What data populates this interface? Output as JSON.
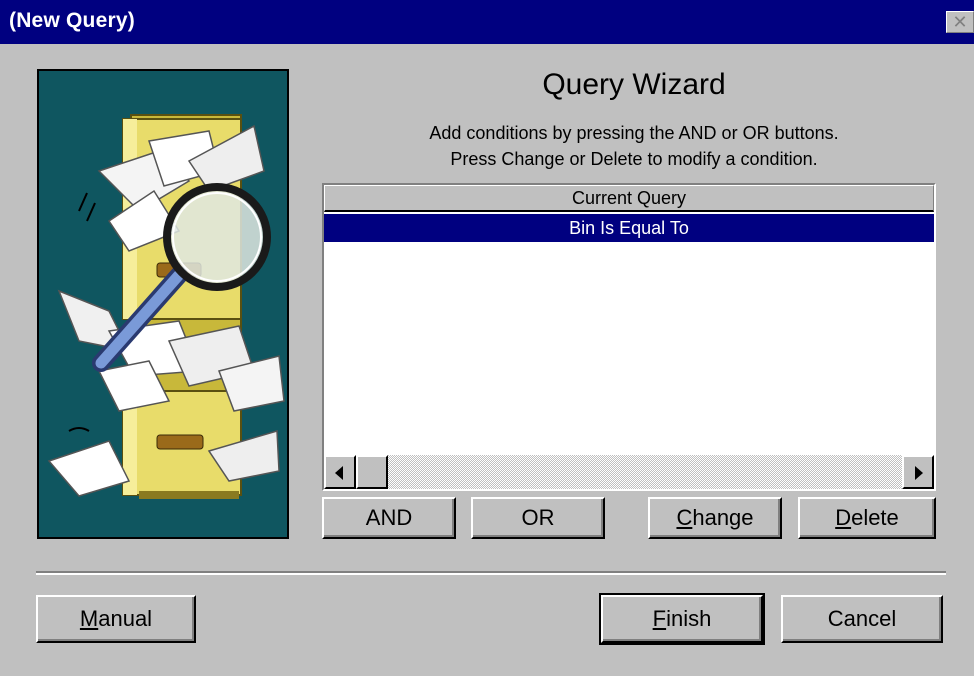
{
  "window": {
    "title": "(New Query)",
    "close_glyph": "✕"
  },
  "illustration": {
    "icon": "file-cabinet-magnifier-icon",
    "background_color": "#0f5660"
  },
  "wizard": {
    "title": "Query Wizard",
    "instruction_line1": "Add conditions by pressing the AND or OR buttons.",
    "instruction_line2": "Press Change or Delete to modify a condition."
  },
  "query_list": {
    "header": "Current Query",
    "rows": [
      "Bin Is Equal To"
    ],
    "selected_color": "#000080"
  },
  "condition_buttons": {
    "and_label": "AND",
    "or_label": "OR",
    "change_mnemonic": "C",
    "change_rest": "hange",
    "delete_mnemonic": "D",
    "delete_rest": "elete"
  },
  "footer_buttons": {
    "manual_mnemonic": "M",
    "manual_rest": "anual",
    "finish_mnemonic": "F",
    "finish_rest": "inish",
    "cancel_label": "Cancel"
  },
  "colors": {
    "titlebar": "#000080",
    "face": "#c0c0c0"
  }
}
